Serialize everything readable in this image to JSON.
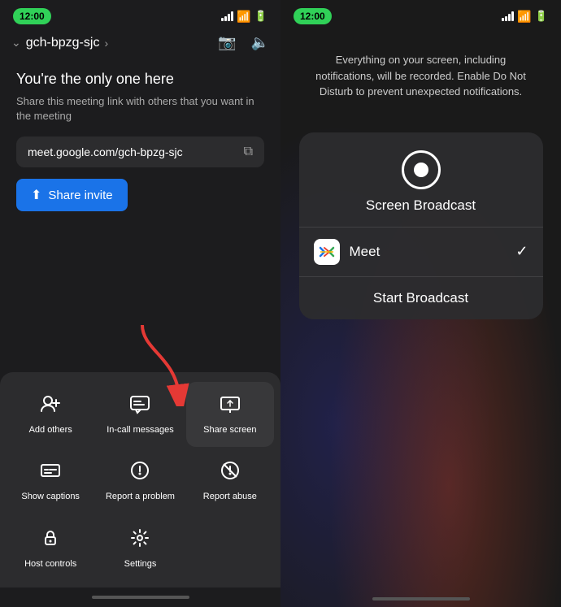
{
  "left": {
    "time": "12:00",
    "meeting_id": "gch-bpzg-sjc",
    "alone_text": "You're the only one here",
    "share_desc": "Share this meeting link with others that you want in the meeting",
    "meet_link": "meet.google.com/gch-bpzg-sjc",
    "share_invite_label": "Share invite",
    "menu_items": [
      {
        "id": "add-others",
        "icon": "👤+",
        "label": "Add others"
      },
      {
        "id": "in-call-messages",
        "icon": "💬",
        "label": "In-call messages"
      },
      {
        "id": "share-screen",
        "icon": "📤",
        "label": "Share screen"
      },
      {
        "id": "show-captions",
        "icon": "⬜",
        "label": "Show captions"
      },
      {
        "id": "report-problem",
        "icon": "⚠",
        "label": "Report a problem"
      },
      {
        "id": "report-abuse",
        "icon": "⓪",
        "label": "Report abuse"
      },
      {
        "id": "host-controls",
        "icon": "🔒",
        "label": "Host controls"
      },
      {
        "id": "settings",
        "icon": "⚙",
        "label": "Settings"
      }
    ]
  },
  "right": {
    "time": "12:00",
    "notice_text": "Everything on your screen, including notifications, will be recorded. Enable Do Not Disturb to prevent unexpected notifications.",
    "screen_broadcast_label": "Screen Broadcast",
    "meet_app_label": "Meet",
    "start_broadcast_label": "Start Broadcast"
  }
}
